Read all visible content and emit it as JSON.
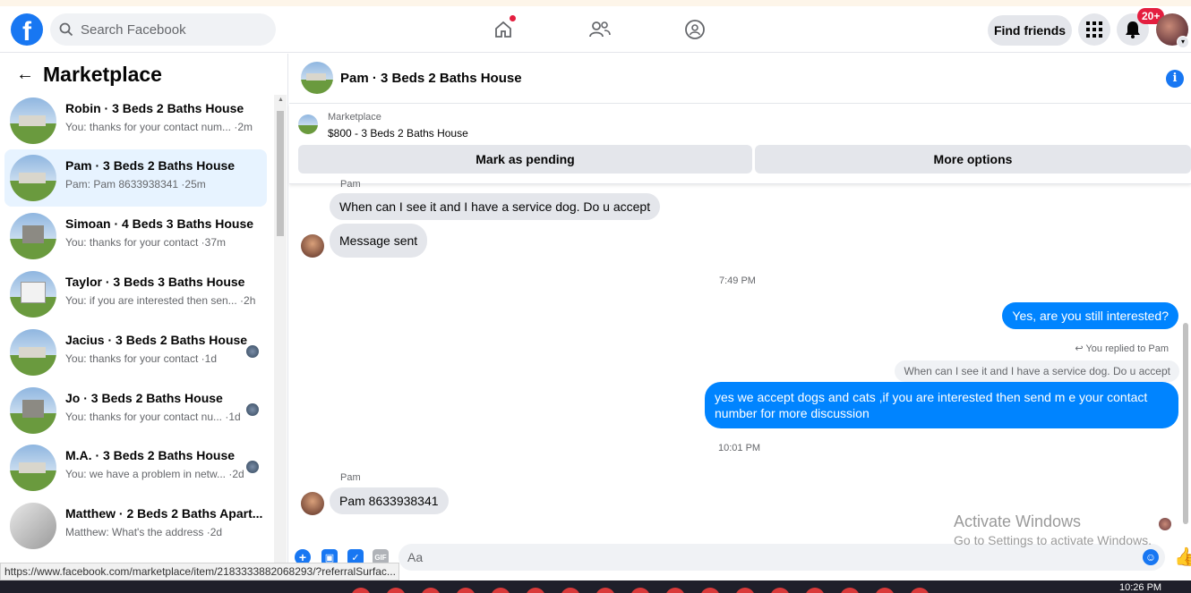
{
  "topbar": {
    "logo_letter": "f",
    "search_placeholder": "Search Facebook",
    "find_friends": "Find friends",
    "notif_badge": "20+"
  },
  "sidebar": {
    "title": "Marketplace",
    "items": [
      {
        "title": "Robin · 3 Beds 2 Baths House",
        "sub": "You: thanks for your contact num... ·2m",
        "thumb": "flat"
      },
      {
        "title": "Pam · 3 Beds 2 Baths House",
        "sub": "Pam: Pam 8633938341 ·25m",
        "thumb": "flat"
      },
      {
        "title": "Simoan · 4 Beds 3 Baths House",
        "sub": "You: thanks for your contact ·37m",
        "thumb": "two"
      },
      {
        "title": "Taylor · 3 Beds 3 Baths House",
        "sub": "You: if you are interested then sen... ·2h",
        "thumb": "white"
      },
      {
        "title": "Jacius · 3 Beds 2 Baths House",
        "sub": "You: thanks for your contact ·1d",
        "thumb": "flat"
      },
      {
        "title": "Jo · 3 Beds 2 Baths House",
        "sub": "You: thanks for your contact nu... ·1d",
        "thumb": "two"
      },
      {
        "title": "M.A. · 3 Beds 2 Baths House",
        "sub": "You: we have a problem in netw... ·2d",
        "thumb": "flat"
      },
      {
        "title": "Matthew · 2 Beds 2 Baths Apart...",
        "sub": "Matthew: What's the address ·2d",
        "thumb": "indoor"
      }
    ]
  },
  "chat": {
    "title": "Pam · 3 Beds 2 Baths House",
    "listing_label": "Marketplace",
    "listing_price": "$800 - 3 Beds 2 Baths House",
    "btn_pending": "Mark as pending",
    "btn_more": "More options",
    "messages": {
      "sender_top": "Pam",
      "m1": "When can I see it and I have a service dog. Do u accept",
      "m2": "Message sent",
      "time1": "7:49 PM",
      "m3": "Yes, are you still interested?",
      "reply_note": "You replied to Pam",
      "quoted": "When can I see it and I have a service dog. Do u accept",
      "m4": "yes we accept dogs and cats ,if you are interested then send m e your contact number for more discussion",
      "time2": "10:01 PM",
      "sender_bottom": "Pam",
      "m5": "Pam 8633938341"
    },
    "composer_placeholder": "Aa"
  },
  "watermark": {
    "line1": "Activate Windows",
    "line2": "Go to Settings to activate Windows."
  },
  "status_url": "https://www.facebook.com/marketplace/item/2183333882068293/?referralSurfac...",
  "clock": "10:26 PM"
}
